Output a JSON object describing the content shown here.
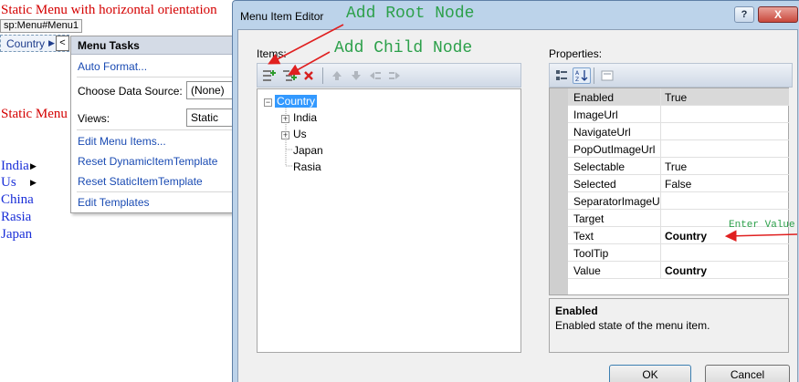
{
  "design_surface": {
    "heading_horizontal": "Static Menu with horizontal orientation",
    "control_tag": "sp:Menu#Menu1",
    "menu_bar_item": "Country",
    "heading_vertical": "Static Menu",
    "vertical_items": [
      {
        "label": "India",
        "has_arrow": true
      },
      {
        "label": "Us",
        "has_arrow": true
      },
      {
        "label": "China",
        "has_arrow": false
      },
      {
        "label": "Rasia",
        "has_arrow": false
      },
      {
        "label": "Japan",
        "has_arrow": false
      }
    ]
  },
  "menu_tasks": {
    "title": "Menu Tasks",
    "auto_format": "Auto Format...",
    "data_source_label": "Choose Data Source:",
    "data_source_value": "(None)",
    "views_label": "Views:",
    "views_value": "Static",
    "edit_menu_items": "Edit Menu Items...",
    "reset_dynamic": "Reset DynamicItemTemplate",
    "reset_static": "Reset StaticItemTemplate",
    "edit_templates": "Edit Templates"
  },
  "dialog": {
    "title": "Menu Item Editor",
    "help_label": "?",
    "close_label": "X",
    "items_label": "Items:",
    "properties_label": "Properties:",
    "tree": {
      "root": "Country",
      "children": [
        "India",
        "Us",
        "Japan",
        "Rasia"
      ]
    },
    "properties": [
      {
        "name": "Enabled",
        "value": "True"
      },
      {
        "name": "ImageUrl",
        "value": ""
      },
      {
        "name": "NavigateUrl",
        "value": ""
      },
      {
        "name": "PopOutImageUrl",
        "value": ""
      },
      {
        "name": "Selectable",
        "value": "True"
      },
      {
        "name": "Selected",
        "value": "False"
      },
      {
        "name": "SeparatorImageUrl",
        "value": ""
      },
      {
        "name": "Target",
        "value": ""
      },
      {
        "name": "Text",
        "value": "Country"
      },
      {
        "name": "ToolTip",
        "value": ""
      },
      {
        "name": "Value",
        "value": "Country"
      }
    ],
    "description_title": "Enabled",
    "description_text": "Enabled state of the menu item.",
    "ok_label": "OK",
    "cancel_label": "Cancel"
  },
  "annotations": {
    "add_root": "Add Root Node",
    "add_child": "Add Child Node",
    "enter_value": "Enter Value",
    "color": "#2ca04a",
    "arrow_color": "#e02020"
  },
  "colors": {
    "static_heading": "#d40000",
    "vertical_menu_text": "#1a2fd8",
    "link": "#1a4bb3",
    "dialog_frame": "#bcd3ea",
    "tree_selection": "#3399ff"
  }
}
